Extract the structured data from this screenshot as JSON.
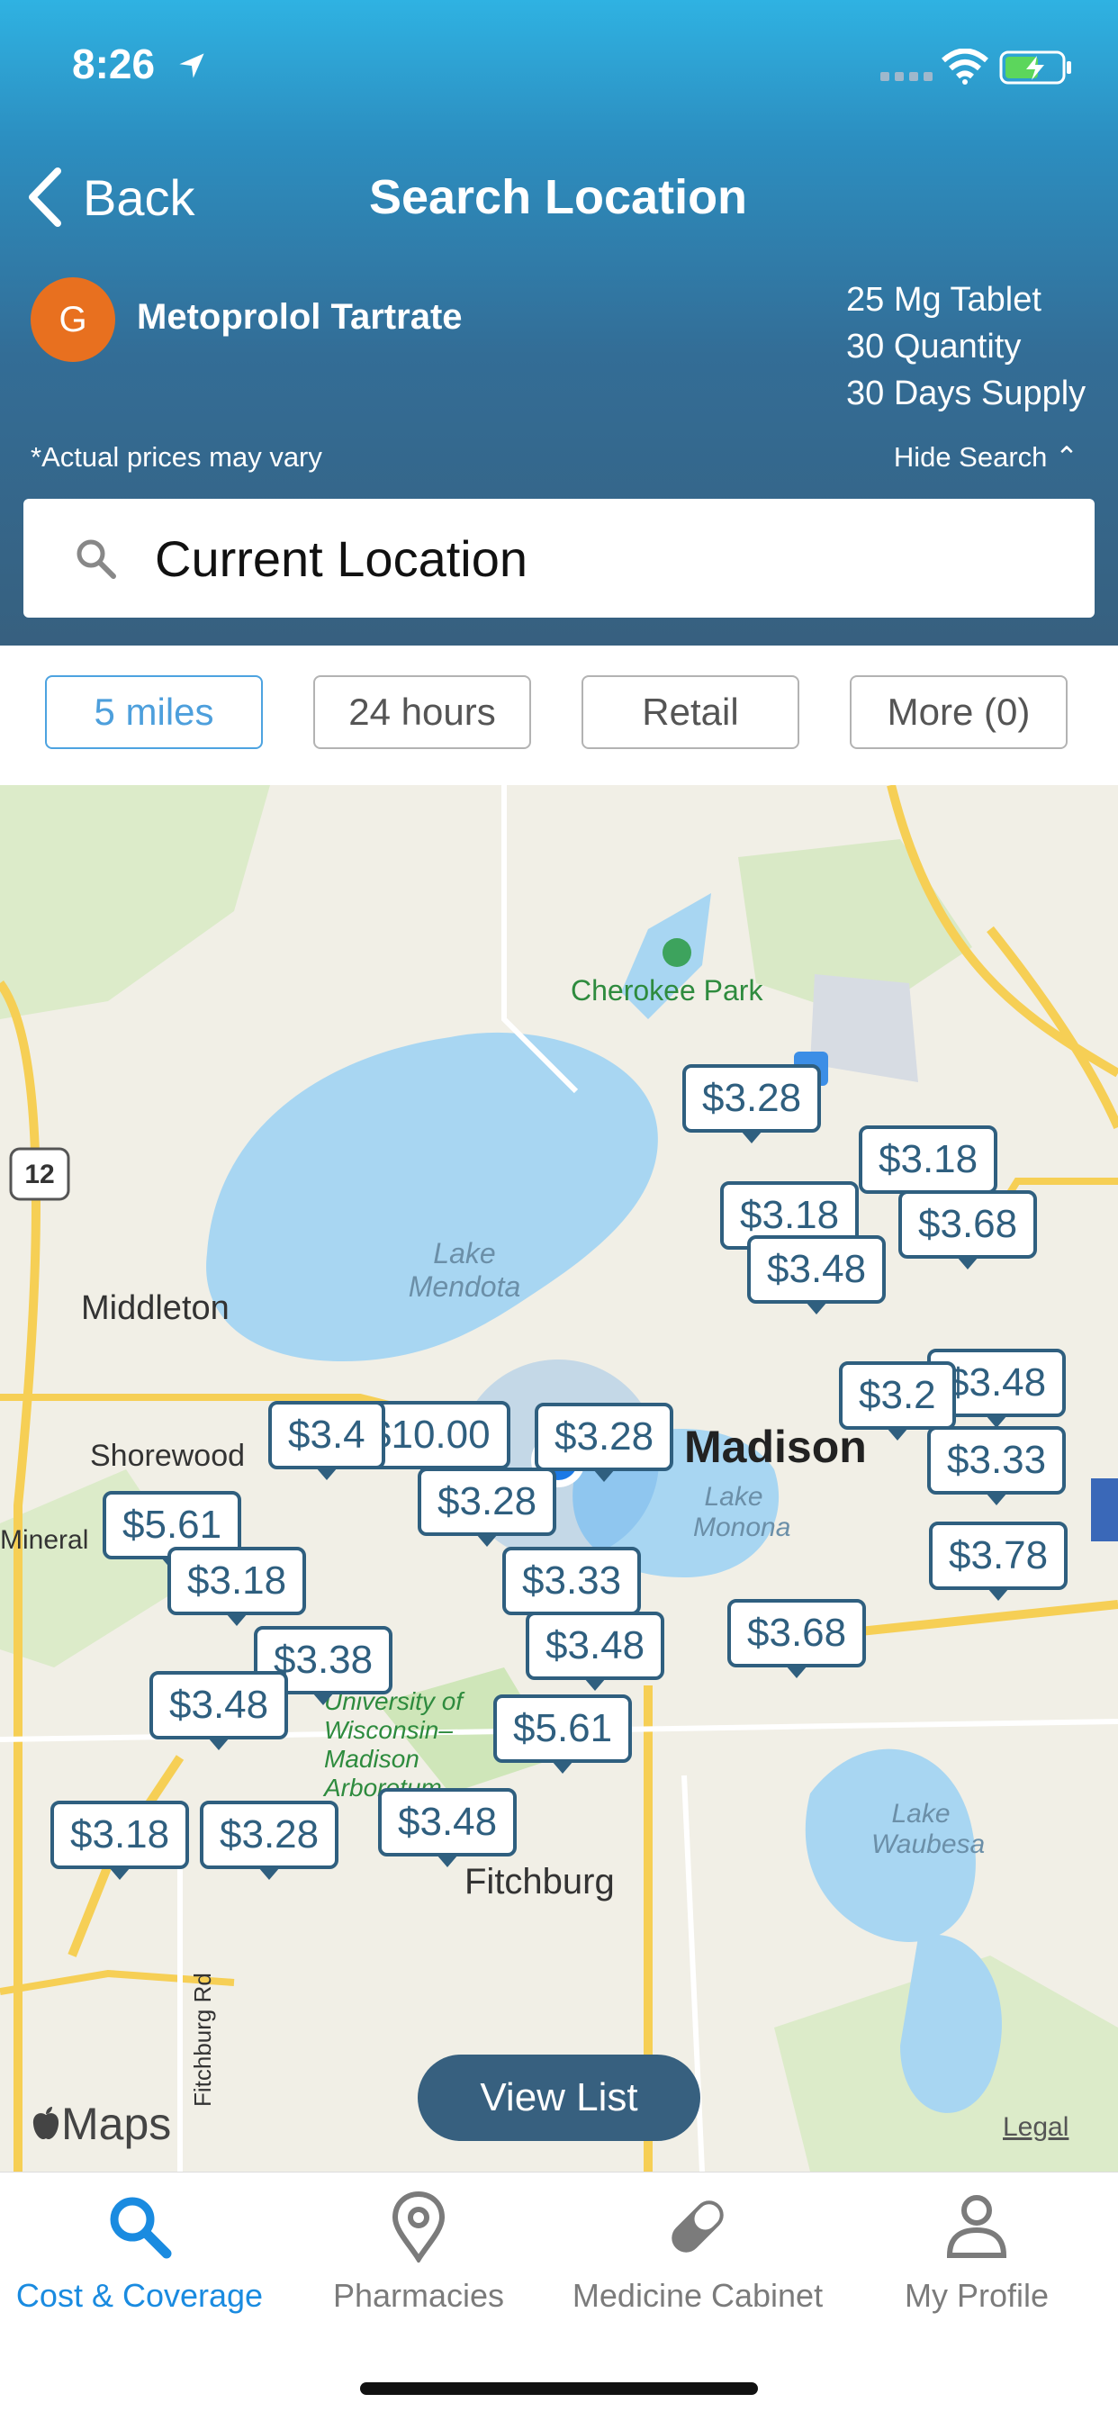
{
  "status_bar": {
    "time": "8:26"
  },
  "nav": {
    "back_label": "Back",
    "title": "Search Location"
  },
  "drug": {
    "avatar_letter": "G",
    "name": "Metoprolol Tartrate",
    "strength": "25 Mg Tablet",
    "quantity": "30 Quantity",
    "supply": "30 Days Supply"
  },
  "disclaimer": "*Actual prices may vary",
  "hide_search_label": "Hide Search ⌃",
  "search": {
    "value": "Current Location"
  },
  "filters": [
    "5 miles",
    "24 hours",
    "Retail",
    "More (0)"
  ],
  "map": {
    "place_labels": [
      "Cherokee Park",
      "Lake Mendota",
      "Middleton",
      "Shorewood",
      "Mineral",
      "Lake Monona",
      "Fitchburg",
      "Lake Waubesa",
      "University of Wisconsin–Madison Arboretum",
      "Madison",
      "Fitchburg Rd",
      "12"
    ],
    "price_pins": [
      "$3.28",
      "$3.18",
      "$3.68",
      "$3.18",
      "$3.48",
      "$3.48",
      "$3.2",
      "$3.33",
      "$10.00",
      "$3.28",
      "$3.4",
      "$3.28",
      "$5.61",
      "$3.18",
      "$3.33",
      "$3.38",
      "$3.48",
      "$3.48",
      "$3.78",
      "$3.68",
      "$5.61",
      "$3.18",
      "$3.28",
      "$3.48"
    ],
    "view_list_label": "View List",
    "legal_label": "Legal",
    "logo_text": "Maps"
  },
  "tabs": [
    {
      "label": "Cost & Coverage",
      "icon": "search-icon",
      "active": true
    },
    {
      "label": "Pharmacies",
      "icon": "location-pin-icon",
      "active": false
    },
    {
      "label": "Medicine Cabinet",
      "icon": "pill-icon",
      "active": false
    },
    {
      "label": "My Profile",
      "icon": "person-icon",
      "active": false
    }
  ],
  "colors": {
    "header": "#37607f",
    "accent": "#1a8be0",
    "avatar": "#e8701f",
    "pin": "#2f5f7f"
  }
}
